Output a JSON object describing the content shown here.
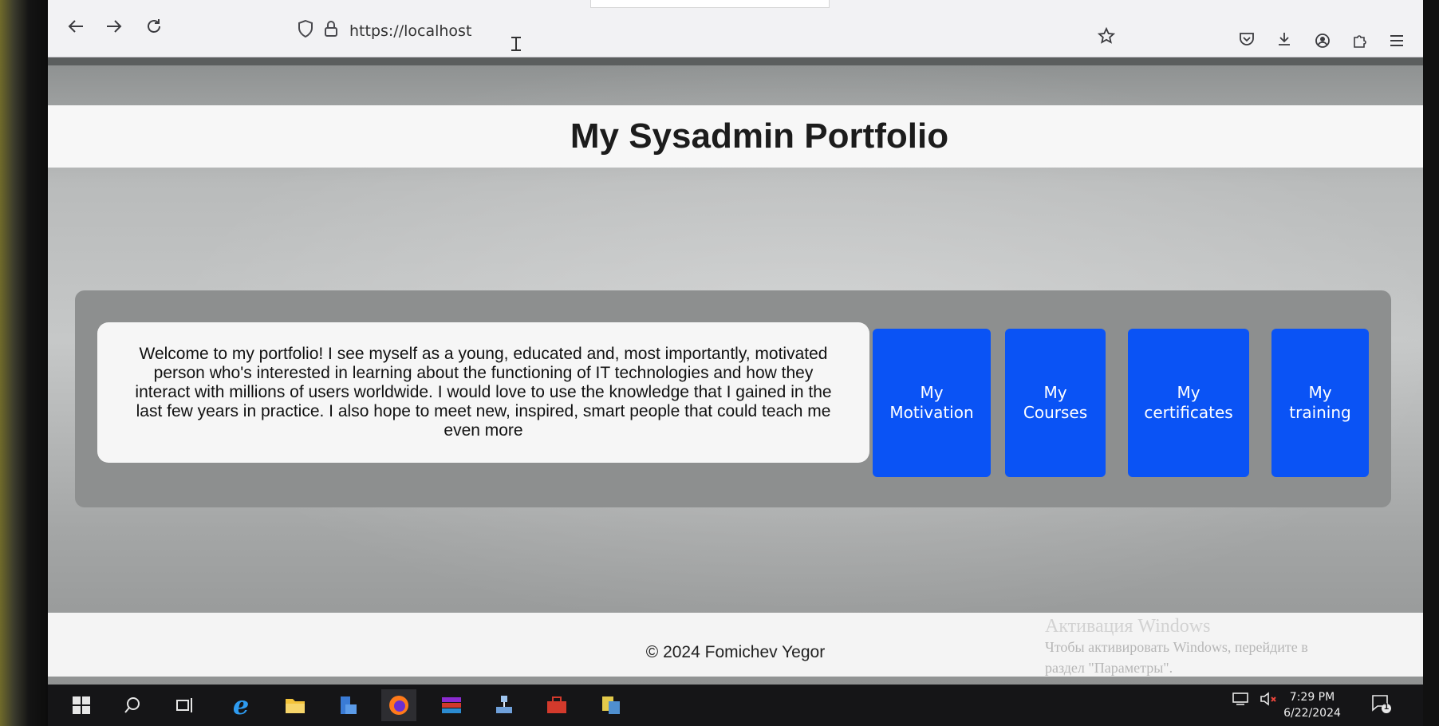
{
  "browser": {
    "url": "https://localhost",
    "icons": {
      "back": "back-arrow-icon",
      "forward": "forward-arrow-icon",
      "reload": "reload-icon",
      "shield": "shield-icon",
      "lock": "lock-icon",
      "bookmark": "star-icon",
      "pocket": "pocket-icon",
      "downloads": "download-icon",
      "account": "account-icon",
      "extensions": "puzzle-icon",
      "menu": "hamburger-menu-icon"
    }
  },
  "header": {
    "title": "My Sysadmin Portfolio"
  },
  "main": {
    "intro": "Welcome to my portfolio! I see myself as a young, educated and, most importantly, motivated person who's interested in learning about the functioning of IT technologies and how they interact with millions of users worldwide. I would love to use the knowledge that I gained in the last few years in practice. I also hope to meet new, inspired, smart people that could teach me even more",
    "buttons": [
      {
        "label": "My Motivation"
      },
      {
        "label": "My Courses"
      },
      {
        "label": "My certificates"
      },
      {
        "label": "My training"
      }
    ],
    "button_color": "#0a53f5"
  },
  "footer": {
    "text": "© 2024 Fomichev Yegor"
  },
  "windows_activation": {
    "title": "Активация Windows",
    "line1": "Чтобы активировать Windows, перейдите в",
    "line2": "раздел \"Параметры\"."
  },
  "taskbar": {
    "time": "7:29 PM",
    "date": "6/22/2024",
    "notifications": "1"
  }
}
